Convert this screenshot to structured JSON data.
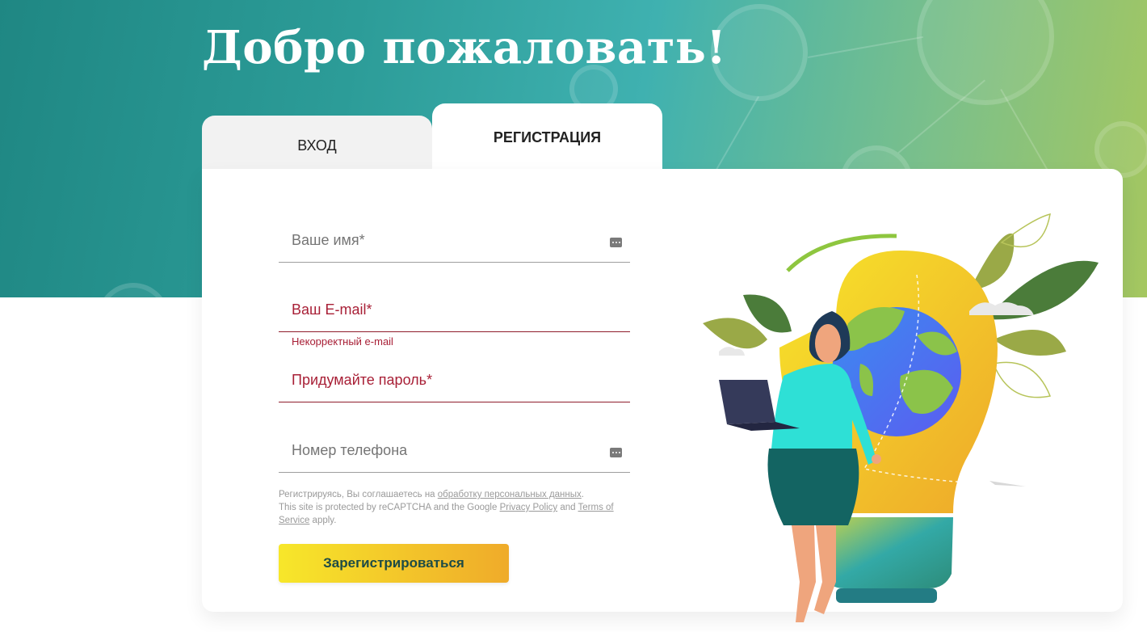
{
  "page": {
    "title": "Добро пожаловать!"
  },
  "tabs": [
    {
      "label": "ВХОД",
      "active": false
    },
    {
      "label": "РЕГИСТРАЦИЯ",
      "active": true
    }
  ],
  "form": {
    "name_label": "Ваше имя*",
    "email_label": "Ваш E-mail*",
    "email_error": "Некорректный e-mail",
    "password_label": "Придумайте пароль*",
    "phone_label": "Номер телефона",
    "consent_prefix": "Регистрируясь, Вы соглашаетесь на ",
    "consent_link": "обработку персональных данных",
    "consent_suffix": ".",
    "recaptcha_prefix": "This site is protected by reCAPTCHA and the Google ",
    "privacy_link": "Privacy Policy",
    "recaptcha_and": " and ",
    "terms_link": "Terms of Service",
    "recaptcha_suffix": " apply.",
    "submit_label": "Зарегистрироваться"
  },
  "icons": {
    "field_icon": "password-manager-key-icon"
  },
  "colors": {
    "error": "#a81f36",
    "button_start": "#f7e72a",
    "button_end": "#efab2a",
    "button_text": "#1d4b46",
    "hero_start": "#1f8783",
    "hero_end": "#a5c75f"
  }
}
